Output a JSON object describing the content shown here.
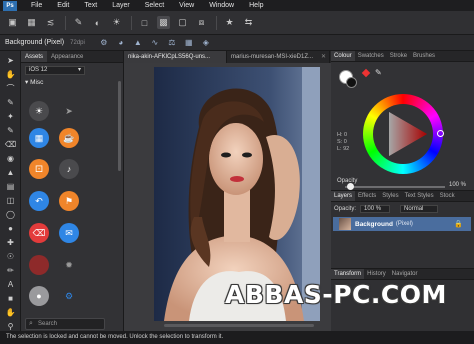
{
  "menubar": {
    "logo": "Ps",
    "items": [
      "File",
      "Edit",
      "Text",
      "Layer",
      "Select",
      "View",
      "Window",
      "Help"
    ]
  },
  "context": {
    "title": "Background (Pixel)",
    "dpi": "72dpi"
  },
  "assets": {
    "tabs": [
      "Assets",
      "Appearance"
    ],
    "selected_set": "iOS 12",
    "category": "Misc",
    "search_placeholder": "Search"
  },
  "document": {
    "tabs": [
      "nika-akin-AFKlCpLS56Q-uns...",
      "marius-muresan-MSI-xieD1Z..."
    ]
  },
  "colour_panel": {
    "tabs": [
      "Colour",
      "Swatches",
      "Stroke",
      "Brushes"
    ],
    "hsl": [
      "H: 0",
      "S: 0",
      "L: 92"
    ],
    "opacity_label": "Opacity",
    "opacity_value": "100 %",
    "opacity": 1.0
  },
  "layers_panel": {
    "tabs": [
      "Layers",
      "Effects",
      "Styles",
      "Text Styles",
      "Stock"
    ],
    "opacity_label": "Opacity:",
    "opacity_value": "100 %",
    "blend_mode": "Normal",
    "layer_name": "Background",
    "layer_type": "(Pixel)"
  },
  "transform_panel": {
    "tabs": [
      "Transform",
      "History",
      "Navigator"
    ]
  },
  "status": "The selection is locked and cannot be moved. Unlock the selection to transform it.",
  "watermark": "ABBAS-PC.COM"
}
